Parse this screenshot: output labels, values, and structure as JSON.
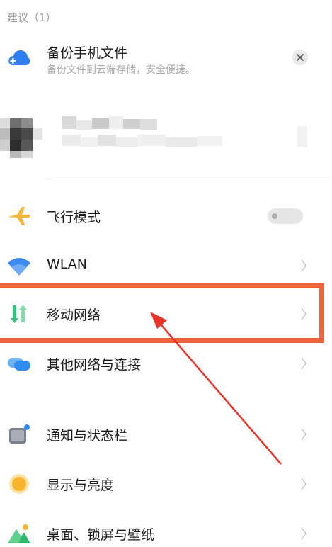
{
  "suggestions": {
    "header": "建议（1）",
    "card": {
      "title": "备份手机文件",
      "subtitle": "备份文件到云端存储，安全便捷。",
      "icon": "cloud-backup-icon",
      "dismiss_icon": "close-icon"
    }
  },
  "account": {
    "name": "",
    "note": "account row is pixelated / blurred in screenshot"
  },
  "settings": [
    {
      "id": "airplane",
      "label": "飞行模式",
      "icon": "airplane-icon",
      "icon_color": "#f3b63a",
      "control": "toggle",
      "toggle_on": false
    },
    {
      "id": "wlan",
      "label": "WLAN",
      "icon": "wifi-icon",
      "icon_color": "#3d8bf2",
      "control": "chevron"
    },
    {
      "id": "mobile-network",
      "label": "移动网络",
      "icon": "mobile-data-icon",
      "icon_color": "#3cc07a",
      "control": "chevron",
      "highlighted": true
    },
    {
      "id": "other-networks",
      "label": "其他网络与连接",
      "icon": "connection-icon",
      "icon_color": "#2f8cf0",
      "control": "chevron"
    },
    {
      "id": "notifications",
      "label": "通知与状态栏",
      "icon": "notification-icon",
      "icon_color": "#7a7f8c",
      "control": "chevron"
    },
    {
      "id": "display",
      "label": "显示与亮度",
      "icon": "sun-icon",
      "icon_color": "#f6b52d",
      "control": "chevron"
    },
    {
      "id": "wallpaper",
      "label": "桌面、锁屏与壁纸",
      "icon": "wallpaper-icon",
      "icon_color": "#33b86b",
      "control": "chevron"
    }
  ],
  "annotation": {
    "highlight_color": "#f0643c",
    "arrow_color": "#e8332a"
  }
}
